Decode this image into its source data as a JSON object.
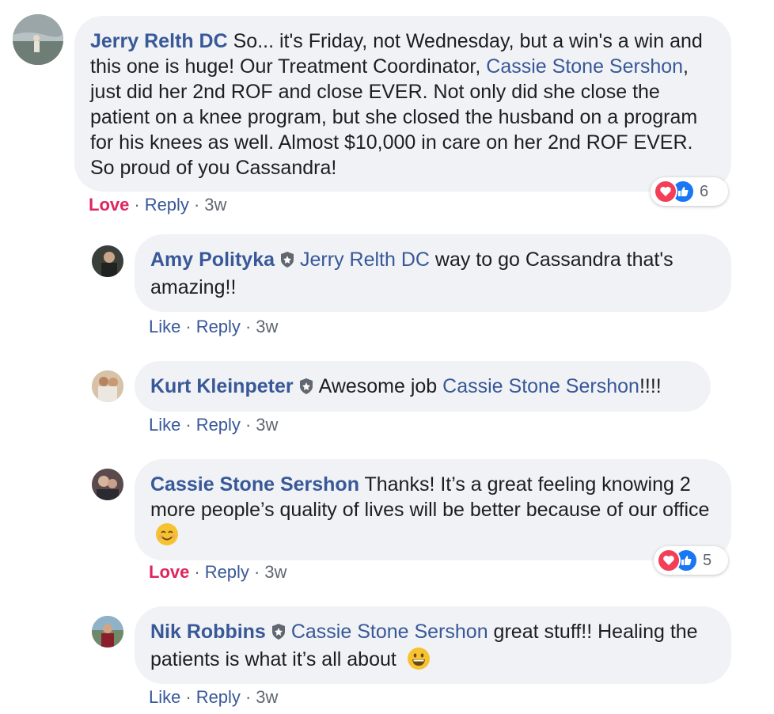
{
  "comments": [
    {
      "author": "Jerry Relth DC",
      "text_1": " So... it's Friday, not Wednesday, but a win's a win and this one is huge! Our Treatment Coordinator, ",
      "mention": "Cassie Stone Sershon",
      "text_2": ", just did her 2nd ROF and close EVER. Not only did she close the patient on a knee program, but she closed the husband on a program for his knees as well. Almost $10,000 in care on her 2nd ROF EVER. So proud of you Cassandra!",
      "reaction_label": "Love",
      "reply_label": "Reply",
      "time": "3w",
      "reaction_count": "6"
    }
  ],
  "replies": [
    {
      "author": "Amy Polityka",
      "mention": "Jerry Relth DC",
      "text": " way to go Cassandra that's amazing!!",
      "like_label": "Like",
      "reply_label": "Reply",
      "time": "3w"
    },
    {
      "author": "Kurt Kleinpeter",
      "text_1": "Awesome job ",
      "mention": "Cassie Stone Sershon",
      "text_2": "!!!!",
      "like_label": "Like",
      "reply_label": "Reply",
      "time": "3w"
    },
    {
      "author": "Cassie Stone Sershon",
      "text": " Thanks! It’s a great feeling knowing 2 more people’s quality of lives will be better because of our office ",
      "reaction_label": "Love",
      "reply_label": "Reply",
      "time": "3w",
      "reaction_count": "5"
    },
    {
      "author": "Nik Robbins",
      "mention": "Cassie Stone Sershon",
      "text": " great stuff!! Healing the patients is what it’s all about ",
      "like_label": "Like",
      "reply_label": "Reply",
      "time": "3w"
    }
  ],
  "icons": {
    "admin_badge": "shield-icon",
    "reaction_love": "heart-icon",
    "reaction_like": "thumbs-up-icon",
    "emoji_smile": "smiling-face-emoji",
    "emoji_grin": "grinning-face-emoji"
  },
  "colors": {
    "link": "#385898",
    "love": "#e0245e",
    "bubble": "#f0f2f5",
    "meta": "#606770"
  }
}
